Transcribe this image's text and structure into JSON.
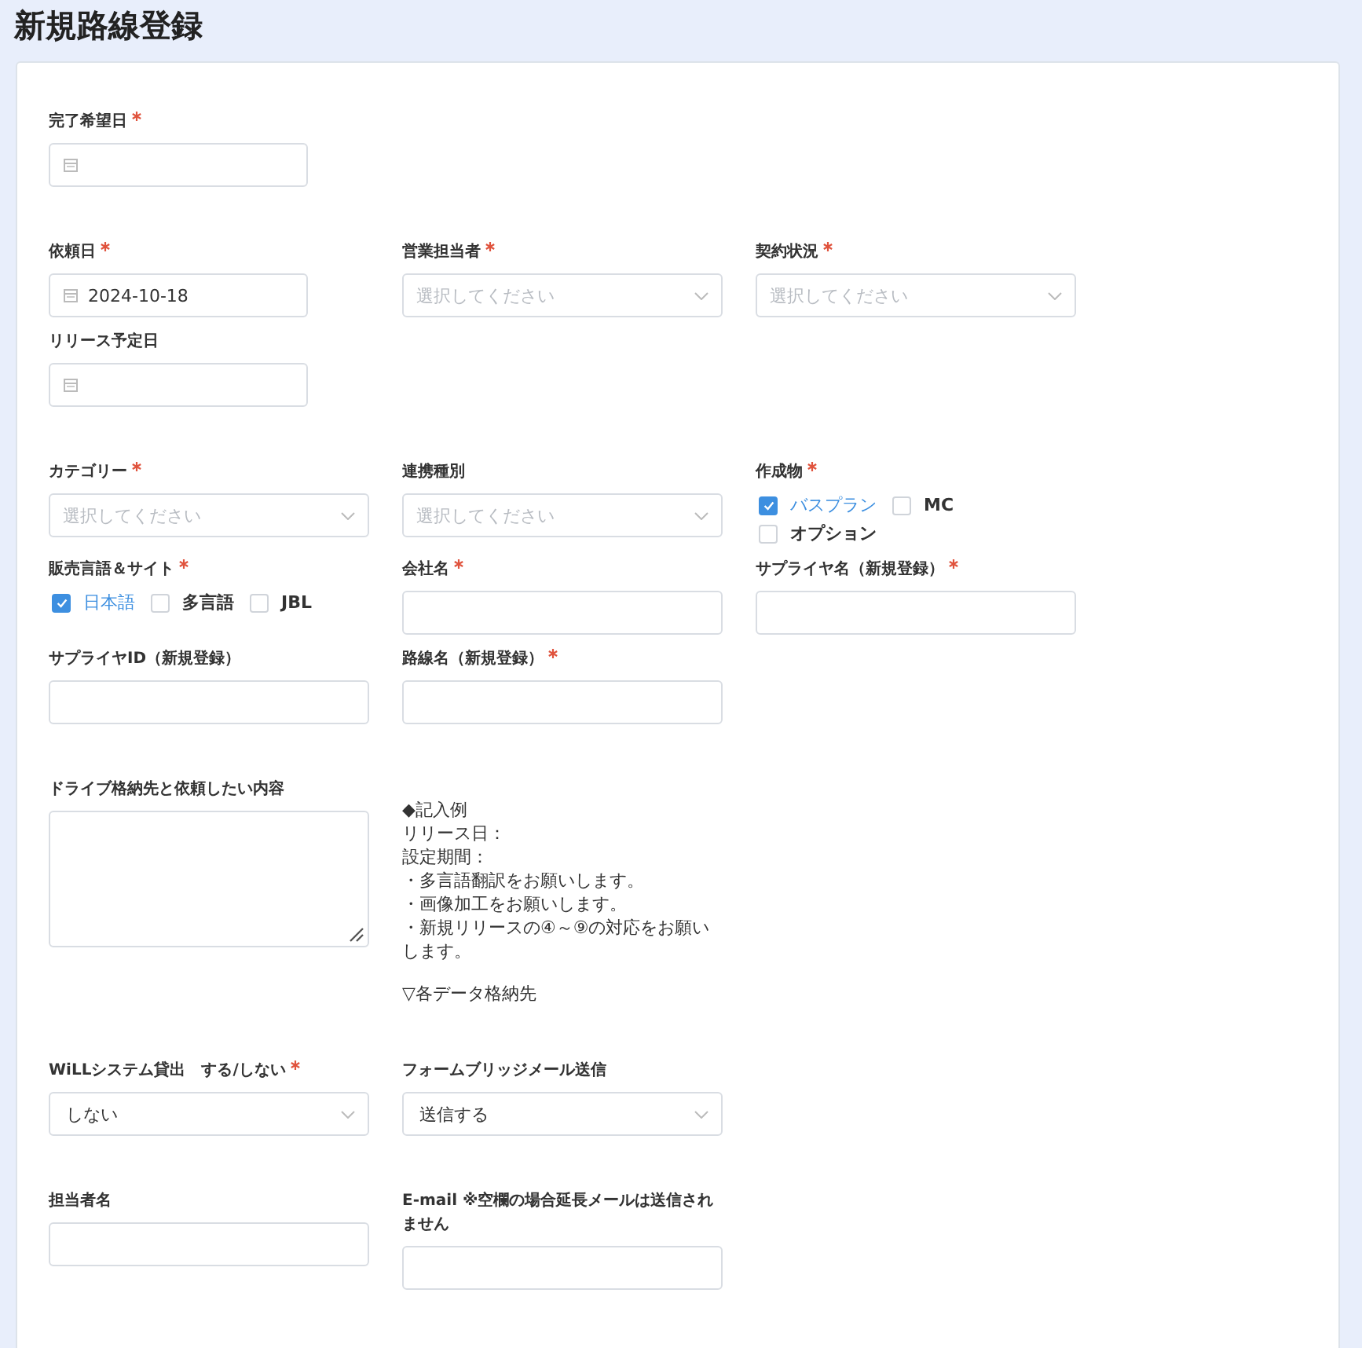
{
  "title": "新規路線登録",
  "sections": [
    {
      "fields": [
        {
          "kind": "date",
          "label": "完了希望日",
          "required": true
        }
      ]
    },
    {
      "fields": [
        {
          "kind": "date",
          "label": "依頼日",
          "required": true,
          "value": "2024-10-18"
        },
        {
          "kind": "select",
          "label": "営業担当者",
          "required": true,
          "placeholder": "選択してください"
        },
        {
          "kind": "select",
          "label": "契約状況",
          "required": true,
          "placeholder": "選択してください"
        },
        {
          "kind": "date",
          "label": "リリース予定日",
          "required": false
        }
      ]
    },
    {
      "fields": [
        {
          "kind": "select",
          "label": "カテゴリー",
          "required": true,
          "placeholder": "選択してください"
        },
        {
          "kind": "select",
          "label": "連携種別",
          "required": false,
          "placeholder": "選択してください"
        },
        {
          "kind": "checkboxes",
          "label": "作成物",
          "required": true,
          "options": [
            {
              "label": "バスプラン",
              "checked": true
            },
            {
              "label": "MC",
              "checked": false
            },
            {
              "label": "オプション",
              "checked": false
            }
          ]
        },
        {
          "kind": "checkboxes",
          "label": "販売言語＆サイト",
          "required": true,
          "options": [
            {
              "label": "日本語",
              "checked": true
            },
            {
              "label": "多言語",
              "checked": false
            },
            {
              "label": "JBL",
              "checked": false
            }
          ]
        },
        {
          "kind": "text",
          "label": "会社名",
          "required": true
        },
        {
          "kind": "text",
          "label": "サプライヤ名（新規登録）",
          "required": true
        },
        {
          "kind": "text",
          "label": "サプライヤID（新規登録）",
          "required": false
        },
        {
          "kind": "text",
          "label": "路線名（新規登録）",
          "required": true
        }
      ]
    },
    {
      "fields": [
        {
          "kind": "textarea",
          "label": "ドライブ格納先と依頼したい内容",
          "required": false
        },
        {
          "kind": "note",
          "paragraphs": [
            [
              "◆記入例",
              "リリース日：",
              "設定期間：",
              "・多言語翻訳をお願いします。",
              "・画像加工をお願いします。",
              "・新規リリースの④～⑨の対応をお願いします。"
            ],
            [
              "▽各データ格納先"
            ]
          ]
        }
      ]
    },
    {
      "fields": [
        {
          "kind": "select",
          "label": "WiLLシステム貸出　する/しない",
          "required": true,
          "value": "しない"
        },
        {
          "kind": "select",
          "label": "フォームブリッジメール送信",
          "required": false,
          "value": "送信する"
        }
      ]
    },
    {
      "fields": [
        {
          "kind": "text",
          "label": "担当者名",
          "required": false
        },
        {
          "kind": "text",
          "label": "E-mail ※空欄の場合延長メールは送信されません",
          "required": false
        }
      ]
    }
  ]
}
